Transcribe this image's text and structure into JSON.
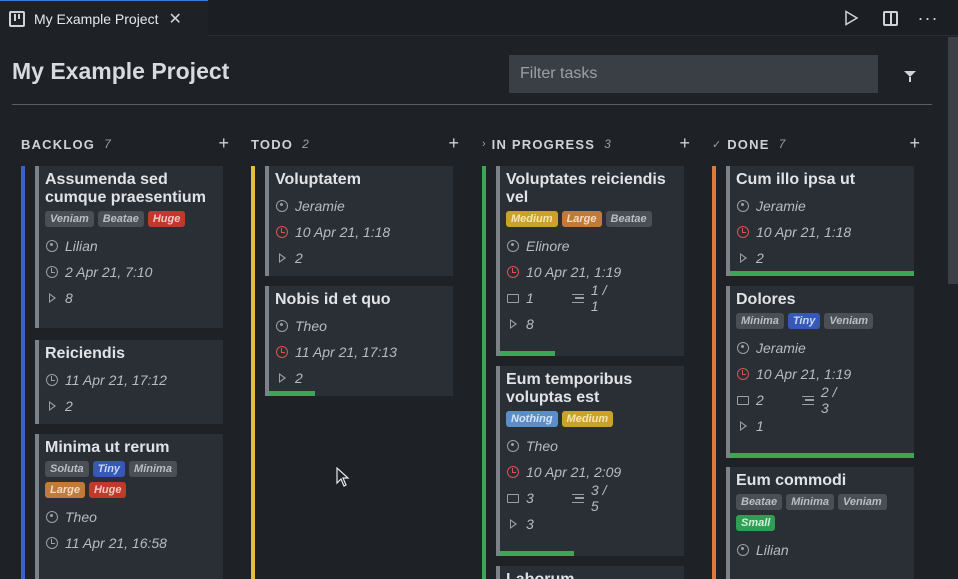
{
  "tab": {
    "title": "My Example Project"
  },
  "header": {
    "title": "My Example Project",
    "filter_placeholder": "Filter tasks"
  },
  "colors": {
    "green": "#3aa757",
    "blue_bar": "#3f5fd1",
    "yellow_bar": "#e0c23a",
    "orange_bar": "#e07a3a"
  },
  "columns": [
    {
      "prefix": "",
      "title": "BACKLOG",
      "count": "7",
      "cards": [
        {
          "title": "Assumenda sed cumque praesentium",
          "tags": [
            "Veniam",
            "Beatae",
            "Huge"
          ],
          "assignee": "Lilian",
          "due": "2 Apr 21, 7:10",
          "due_overdue": false,
          "runs": "8"
        },
        {
          "title": "Reiciendis",
          "tags": [],
          "assignee": "",
          "due": "11 Apr 21, 17:12",
          "due_overdue": false,
          "runs": "2"
        },
        {
          "title": "Minima ut rerum",
          "tags": [
            "Soluta",
            "Tiny",
            "Minima",
            "Large",
            "Huge"
          ],
          "assignee": "Theo",
          "due": "11 Apr 21, 16:58",
          "due_overdue": false,
          "runs": ""
        }
      ]
    },
    {
      "prefix": "",
      "title": "TODO",
      "count": "2",
      "cards": [
        {
          "title": "Voluptatem",
          "tags": [],
          "assignee": "Jeramie",
          "due": "10 Apr 21, 1:18",
          "due_overdue": true,
          "runs": "2"
        },
        {
          "title": "Nobis id et quo",
          "tags": [],
          "assignee": "Theo",
          "due": "11 Apr 21, 17:13",
          "due_overdue": true,
          "runs": "2",
          "progress": 0.25
        }
      ]
    },
    {
      "prefix": "›",
      "title": "IN PROGRESS",
      "count": "3",
      "cards": [
        {
          "title": "Voluptates reiciendis vel",
          "tags": [
            "Medium",
            "Large",
            "Beatae"
          ],
          "assignee": "Elinore",
          "due": "10 Apr 21, 1:19",
          "due_overdue": true,
          "comments": "1",
          "subtasks": "1 / 1",
          "runs": "8",
          "progress": 0.3
        },
        {
          "title": "Eum temporibus voluptas est",
          "tags": [
            "Nothing",
            "Medium"
          ],
          "assignee": "Theo",
          "due": "10 Apr 21, 2:09",
          "due_overdue": true,
          "comments": "3",
          "subtasks": "3 / 5",
          "runs": "3",
          "progress": 0.4
        },
        {
          "title": "Laborum",
          "tags": [],
          "assignee": "",
          "due": "",
          "due_overdue": false,
          "runs": ""
        }
      ]
    },
    {
      "prefix": "✓",
      "title": "DONE",
      "count": "7",
      "cards": [
        {
          "title": "Cum illo ipsa ut",
          "tags": [],
          "assignee": "Jeramie",
          "due": "10 Apr 21, 1:18",
          "due_overdue": true,
          "runs": "2",
          "progress": 1
        },
        {
          "title": "Dolores",
          "tags": [
            "Minima",
            "Tiny",
            "Veniam"
          ],
          "assignee": "Jeramie",
          "due": "10 Apr 21, 1:19",
          "due_overdue": true,
          "comments": "2",
          "subtasks": "2 / 3",
          "runs": "1",
          "progress": 1
        },
        {
          "title": "Eum commodi",
          "tags": [
            "Beatae",
            "Minima",
            "Veniam",
            "Small"
          ],
          "assignee": "Lilian",
          "due": "",
          "due_overdue": false,
          "runs": ""
        }
      ]
    }
  ],
  "tag_colors": {
    "Veniam": {
      "bg": "#4a4f56",
      "fg": "#b9bec4"
    },
    "Beatae": {
      "bg": "#4a4f56",
      "fg": "#b9bec4"
    },
    "Huge": {
      "bg": "#c0392b",
      "fg": "#f3c7c2"
    },
    "Soluta": {
      "bg": "#4a4f56",
      "fg": "#b9bec4"
    },
    "Tiny": {
      "bg": "#3659b8",
      "fg": "#c9d6f5"
    },
    "Minima": {
      "bg": "#4a4f56",
      "fg": "#b9bec4"
    },
    "Large": {
      "bg": "#c07a3a",
      "fg": "#f3dcc6"
    },
    "Medium": {
      "bg": "#c9a227",
      "fg": "#f5e6b3"
    },
    "Nothing": {
      "bg": "#5b8ec9",
      "fg": "#d5e4f5"
    },
    "Small": {
      "bg": "#2f9e55",
      "fg": "#d0f0da"
    }
  }
}
